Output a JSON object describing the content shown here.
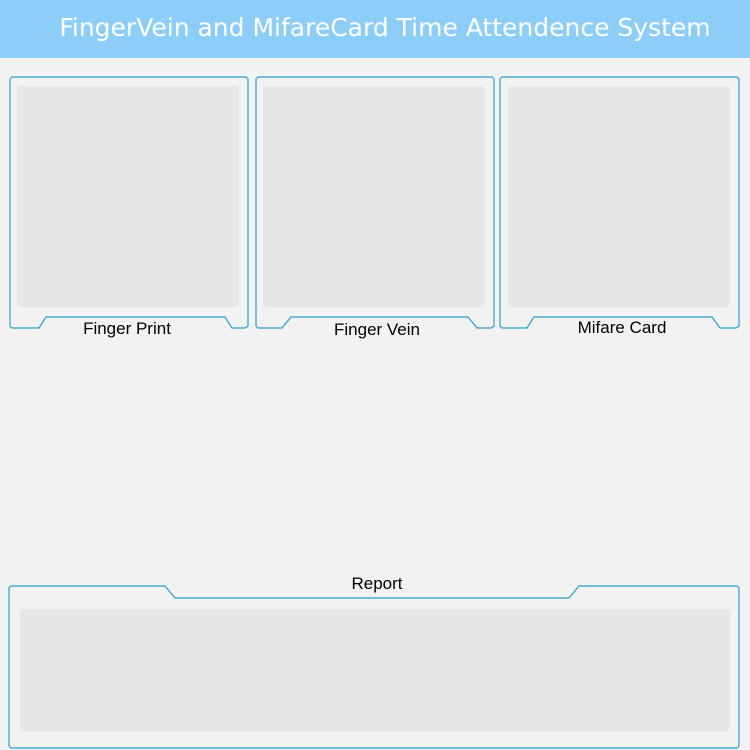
{
  "header": {
    "title": "FingerVein and MifareCard Time Attendence System",
    "background_color": "#8ccef7"
  },
  "panels": {
    "finger_print": {
      "label": "Finger Print"
    },
    "finger_vein": {
      "label": "Finger Vein"
    },
    "mifare_card": {
      "label": "Mifare Card"
    },
    "report": {
      "label": "Report"
    }
  },
  "colors": {
    "frame_border": "#2a9fd0",
    "display_area": "#e6e6e6",
    "background": "#f2f2f2"
  }
}
